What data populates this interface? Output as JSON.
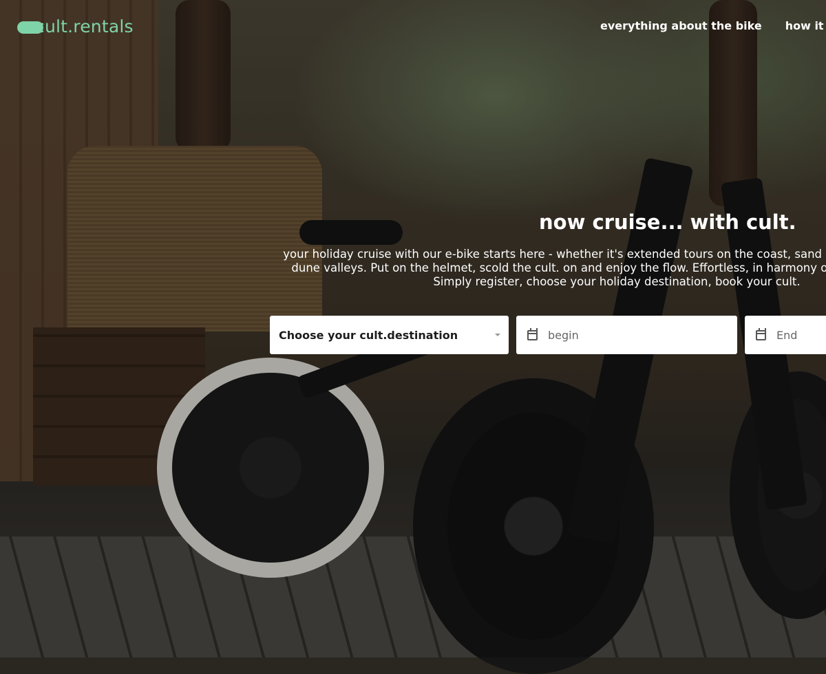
{
  "brand": {
    "logo_text": "cult.rentals",
    "accent_color": "#7fd3a8"
  },
  "nav": {
    "items": [
      "everything about the bike",
      "how it works"
    ]
  },
  "hero": {
    "headline": "now cruise... with cult.",
    "intro": "your holiday cruise with our e-bike starts here - whether it's extended tours on the coast, sand paths in the middle of dune valleys. Put on the helmet, scold the cult. on and enjoy the flow. Effortless, in harmony of your surroundings. Simply register, choose your holiday destination, book your cult.",
    "background_image": "two black e-bikes parked on a wooden deck"
  },
  "booking": {
    "destination_placeholder": "Choose your cult.destination",
    "begin_placeholder": "begin",
    "end_placeholder": "End",
    "icons": {
      "destination": "chevron-down-icon",
      "begin": "calendar-icon",
      "end": "calendar-icon"
    }
  }
}
